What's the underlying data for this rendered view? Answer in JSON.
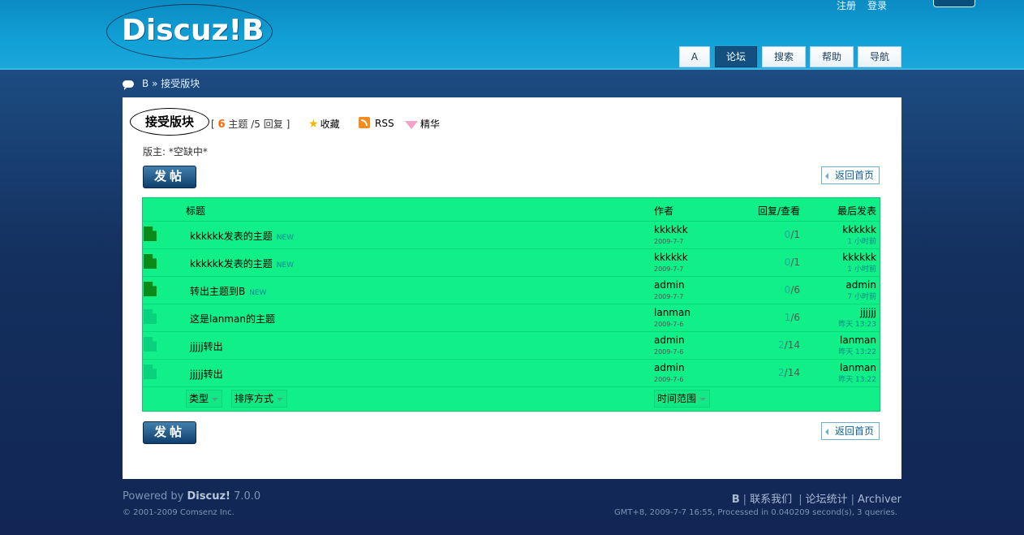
{
  "header": {
    "logo_text": "Discuz!B",
    "toplinks": [
      "注册",
      "登录"
    ],
    "nav": [
      "A",
      "论坛",
      "搜索",
      "帮助",
      "导航"
    ],
    "nav_active": "论坛"
  },
  "breadcrumb": {
    "home": "B",
    "separator": "»",
    "current": "接受版块"
  },
  "forum": {
    "title": "接受版块",
    "topics_count": "6",
    "topics_label": "主题",
    "replies_label": "5 回复",
    "bracket_open": "[",
    "bracket_close": "]",
    "slash": "/",
    "favorite": "收藏",
    "rss": "RSS",
    "digest": "精华",
    "moderator": "版主: *空缺中*",
    "post_button": "发帖",
    "back_button": "返回首页"
  },
  "table": {
    "headers": {
      "title": "标题",
      "author": "作者",
      "replies_views": "回复/查看",
      "last_post": "最后发表"
    },
    "rows": [
      {
        "title": "kkkkkk发表的主题",
        "new_tag": "NEW",
        "author": "kkkkkk",
        "date": "2009-7-7",
        "replies": "0",
        "views": "1",
        "last_by": "kkkkkk",
        "last_time": "1 小时前",
        "icon": "new"
      },
      {
        "title": "kkkkkk发表的主题",
        "new_tag": "NEW",
        "author": "kkkkkk",
        "date": "2009-7-7",
        "replies": "0",
        "views": "1",
        "last_by": "kkkkkk",
        "last_time": "1 小时前",
        "icon": "new"
      },
      {
        "title": "转出主题到B",
        "new_tag": "NEW",
        "author": "admin",
        "date": "2009-7-7",
        "replies": "0",
        "views": "6",
        "last_by": "admin",
        "last_time": "7 小时前",
        "icon": "new"
      },
      {
        "title": "这是lanman的主题",
        "new_tag": "",
        "author": "lanman",
        "date": "2009-7-6",
        "replies": "1",
        "views": "6",
        "last_by": "jjjjjj",
        "last_time": "昨天 13:23",
        "icon": "old"
      },
      {
        "title": "jjjjj转出",
        "new_tag": "",
        "author": "admin",
        "date": "2009-7-6",
        "replies": "2",
        "views": "14",
        "last_by": "lanman",
        "last_time": "昨天 13:22",
        "icon": "old"
      },
      {
        "title": "jjjjj转出",
        "new_tag": "",
        "author": "admin",
        "date": "2009-7-6",
        "replies": "2",
        "views": "14",
        "last_by": "lanman",
        "last_time": "昨天 13:22",
        "icon": "old"
      }
    ],
    "filters": {
      "type": "类型",
      "sort": "排序方式",
      "time_range": "时间范围"
    }
  },
  "footer": {
    "powered_prefix": "Powered by",
    "powered_brand": "Discuz!",
    "powered_version": "7.0.0",
    "copyright": "© 2001-2009 Comsenz Inc.",
    "links": [
      "B",
      "联系我们",
      "论坛统计",
      "Archiver"
    ],
    "gmt": "GMT+8, 2009-7-7 16:55, Processed in 0.040209 second(s), 3 queries."
  }
}
